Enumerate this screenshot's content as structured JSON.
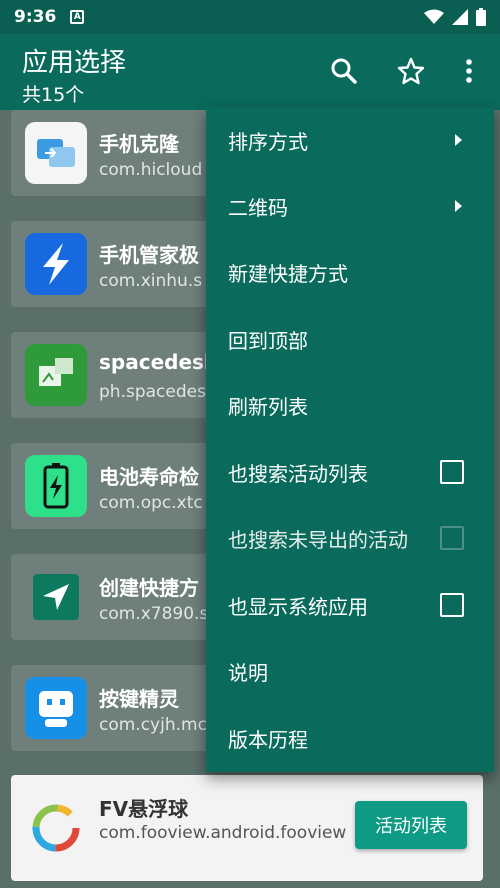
{
  "status_bar": {
    "time": "9:36",
    "notification_letter": "A"
  },
  "toolbar": {
    "title": "应用选择",
    "subtitle": "共15个"
  },
  "apps": [
    {
      "name": "手机克隆",
      "package": "com.hicloud"
    },
    {
      "name": "手机管家极",
      "package": "com.xinhu.s"
    },
    {
      "name": "spacedesk",
      "package": "ph.spacedes"
    },
    {
      "name": "电池寿命检",
      "package": "com.opc.xtc"
    },
    {
      "name": "创建快捷方",
      "package": "com.x7890.s"
    },
    {
      "name": "按键精灵",
      "package": "com.cyjh.mc"
    },
    {
      "name": "FV悬浮球",
      "package": "com.fooview.android.fooview",
      "action_label": "活动列表"
    }
  ],
  "menu": {
    "items": [
      {
        "label": "排序方式",
        "kind": "submenu"
      },
      {
        "label": "二维码",
        "kind": "submenu"
      },
      {
        "label": "新建快捷方式",
        "kind": "plain"
      },
      {
        "label": "回到顶部",
        "kind": "plain"
      },
      {
        "label": "刷新列表",
        "kind": "plain"
      },
      {
        "label": "也搜索活动列表",
        "kind": "checkbox",
        "checked": false,
        "enabled": true
      },
      {
        "label": "也搜索未导出的活动",
        "kind": "checkbox",
        "checked": false,
        "enabled": false
      },
      {
        "label": "也显示系统应用",
        "kind": "checkbox",
        "checked": false,
        "enabled": true
      },
      {
        "label": "说明",
        "kind": "plain"
      },
      {
        "label": "版本历程",
        "kind": "plain"
      }
    ]
  },
  "colors": {
    "primary": "#0a6a5c",
    "status_bar": "#0b5f52",
    "accent_button": "#0e9b86"
  },
  "icons": {
    "search": "search-icon",
    "star": "star-outline-icon",
    "overflow": "more-vert-icon"
  }
}
